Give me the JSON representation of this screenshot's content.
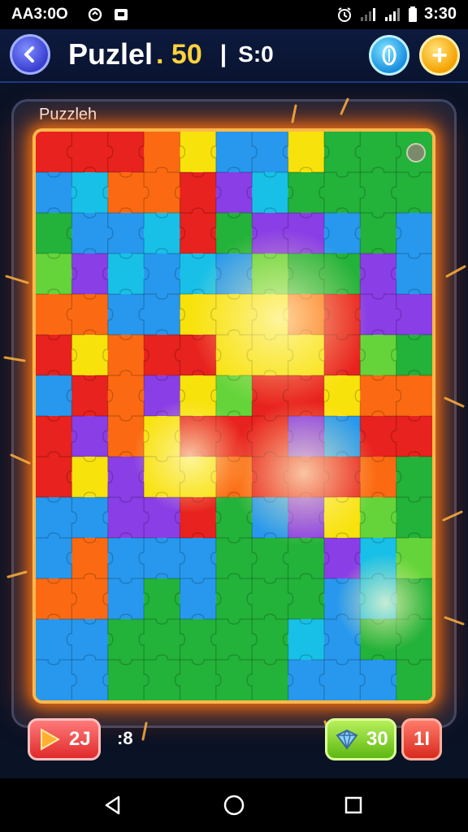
{
  "status_bar": {
    "time_left": "AA3:0O",
    "time_right": "3:30",
    "icons": [
      "app-icon-1",
      "app-icon-2",
      "alarm-icon",
      "signal-icon",
      "signal-icon",
      "battery-icon"
    ]
  },
  "header": {
    "title": "Puzlel",
    "score": ". 50",
    "separator": "|",
    "timer": "S:0",
    "back_icon": "chevron-left-icon",
    "coin_icon": "coin-icon",
    "add_label": "+"
  },
  "board": {
    "label": "Puzzleh",
    "colors": {
      "R": "#e8221e",
      "O": "#fb6a12",
      "Y": "#f8e20c",
      "G": "#23b23a",
      "L": "#64d43a",
      "B": "#2798ee",
      "C": "#18c0e8",
      "P": "#8a3ee6",
      "K": "#f2407a"
    },
    "grid": [
      "RRROYBBYGGG",
      "BCOORPCGGGG",
      "GBBCRGPPBGB",
      "LPCBCBLGGPB",
      "OOBBYYYORPP",
      "RYORRYYYRLG",
      "BROPYLRRYOO",
      "RPOYRRRPBRR",
      "RYPYYORRROG",
      "BBPPRGBPYLG",
      "BOBBBGGGPCL",
      "OOBGBGGGBCG",
      "BBGGGGGCBGG",
      "BBGGGGGBBBG"
    ]
  },
  "bottom_bar": {
    "play_value": "2J",
    "moves": ":8",
    "gem_value": "30",
    "count_value": "1I"
  },
  "nav_bar": {
    "icons": [
      "back-triangle-icon",
      "home-circle-icon",
      "recents-square-icon"
    ]
  }
}
